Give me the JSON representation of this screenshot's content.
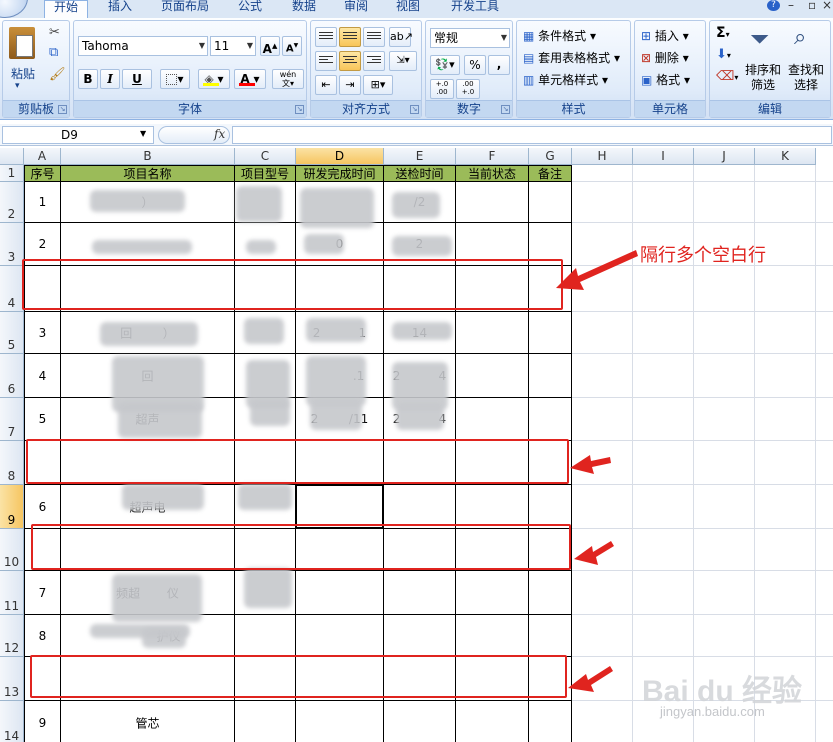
{
  "ribbon": {
    "tabs": [
      "开始",
      "插入",
      "页面布局",
      "公式",
      "数据",
      "审阅",
      "视图",
      "开发工具"
    ],
    "groups": {
      "clipboard": {
        "label": "剪贴板",
        "paste": "粘贴"
      },
      "font": {
        "label": "字体",
        "font_name": "Tahoma",
        "font_size": "11",
        "bold": "B",
        "italic": "I",
        "underline": "U",
        "wen": "wén"
      },
      "alignment": {
        "label": "对齐方式"
      },
      "number": {
        "label": "数字",
        "format": "常规",
        "percent": "%",
        "comma": ",",
        "inc_decimal": "+.0 .00",
        "dec_decimal": ".00 +.0"
      },
      "styles": {
        "label": "样式",
        "conditional": "条件格式",
        "table_format": "套用表格格式",
        "cell_style": "单元格样式"
      },
      "cells": {
        "label": "单元格",
        "insert": "插入",
        "delete": "删除",
        "format": "格式"
      },
      "editing": {
        "label": "编辑",
        "sort_filter": "排序和\n筛选",
        "find_select": "查找和\n选择",
        "sigma": "Σ"
      }
    }
  },
  "formula_bar": {
    "name_box": "D9",
    "fx": "fx",
    "content": ""
  },
  "sheet": {
    "columns": [
      "A",
      "B",
      "C",
      "D",
      "E",
      "F",
      "G",
      "H",
      "I",
      "J",
      "K"
    ],
    "rows": [
      "1",
      "2",
      "3",
      "4",
      "5",
      "6",
      "7",
      "8",
      "9",
      "10",
      "11",
      "12",
      "13",
      "14"
    ],
    "selected_cell": "D9",
    "headers": [
      "序号",
      "项目名称",
      "项目型号",
      "研发完成时间",
      "送检时间",
      "当前状态",
      "备注"
    ],
    "data": [
      {
        "row": 2,
        "A": "1",
        "B": "）",
        "C": "",
        "D": "",
        "E": "/2"
      },
      {
        "row": 3,
        "A": "2",
        "B": "",
        "C": "",
        "D": "0",
        "E": "2"
      },
      {
        "row": 5,
        "A": "3",
        "B": "回        ）",
        "C": "",
        "D": "2          1",
        "E": "14"
      },
      {
        "row": 6,
        "A": "4",
        "B": "回",
        "C": "",
        "D": "          .1",
        "E": "2          4"
      },
      {
        "row": 7,
        "A": "5",
        "B": "超声",
        "C": "",
        "D": "2        /11",
        "E": "2          4"
      },
      {
        "row": 9,
        "A": "6",
        "B": "超声电",
        "C": "",
        "D": "",
        "E": ""
      },
      {
        "row": 11,
        "A": "7",
        "B": "频超       仪",
        "C": "",
        "D": "",
        "E": ""
      },
      {
        "row": 12,
        "A": "8",
        "B": "           护仪",
        "C": "",
        "D": "",
        "E": ""
      },
      {
        "row": 14,
        "A": "9",
        "B": "管芯",
        "C": "",
        "D": "",
        "E": ""
      }
    ]
  },
  "annotation": {
    "text": "隔行多个空白行",
    "color": "#e0241f"
  },
  "watermark": {
    "logo": "Bai du 经验",
    "url": "jingyan.baidu.com"
  }
}
